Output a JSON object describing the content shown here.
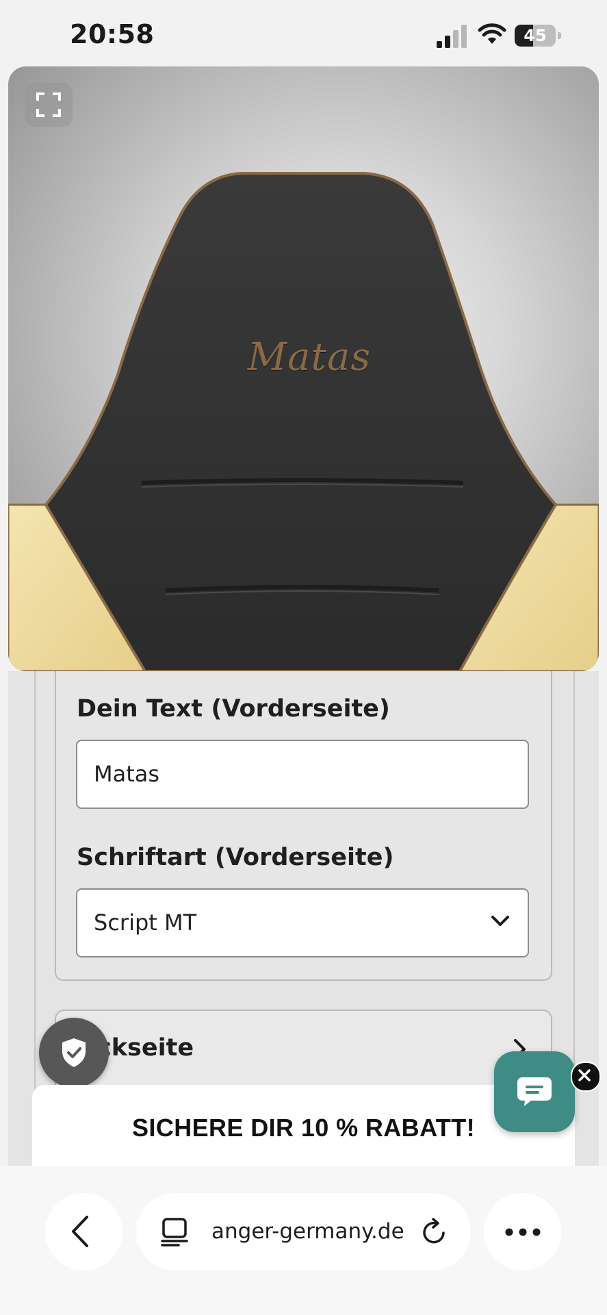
{
  "status_bar": {
    "time": "20:58",
    "battery_level": "45",
    "signal_bars": 2,
    "icons": [
      "signal-icon",
      "wifi-icon",
      "battery-icon"
    ]
  },
  "product_viewer": {
    "seat_text": "Matas",
    "colors": {
      "leather": "#2f2f2f",
      "side_panel": "#f2dfa6",
      "piping": "#8a6a46"
    },
    "icons": [
      "fullscreen-icon"
    ]
  },
  "front_section": {
    "text_label": "Dein Text (Vorderseite)",
    "text_value": "Matas",
    "font_label": "Schriftart (Vorderseite)",
    "font_value": "Script MT"
  },
  "back_section": {
    "label": "ckseite"
  },
  "promo": {
    "text": "SICHERE DIR 10 % RABATT!"
  },
  "chat": {
    "accent": "#3f8b85",
    "icons": [
      "chat-icon",
      "close-icon",
      "shield-check-icon"
    ]
  },
  "browser": {
    "address": "anger-germany.de",
    "icons": [
      "chevron-left-icon",
      "page-icon",
      "reload-icon",
      "more-icon"
    ]
  }
}
